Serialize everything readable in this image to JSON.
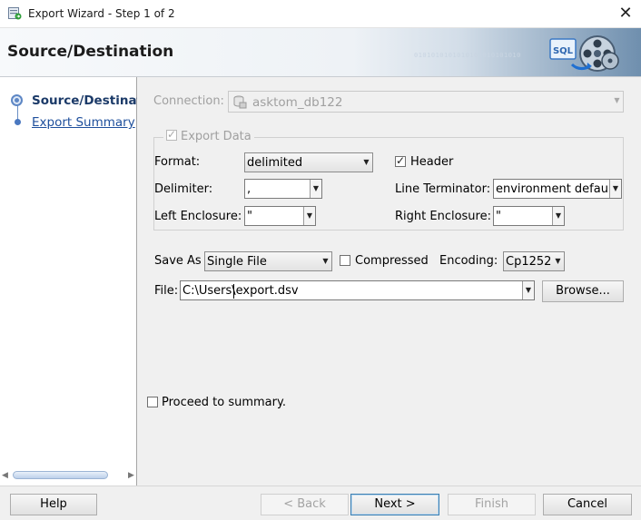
{
  "window": {
    "title": "Export Wizard - Step 1 of 2"
  },
  "header": {
    "title": "Source/Destination",
    "binary_text": "0101010101010101010101010",
    "graphic_label": "SQL"
  },
  "nav": {
    "items": [
      {
        "label": "Source/Destination",
        "state": "current"
      },
      {
        "label": "Export Summary",
        "state": "link"
      }
    ]
  },
  "form": {
    "connection": {
      "label": "Connection:",
      "value": "asktom_db122",
      "enabled": false
    },
    "export_data": {
      "label": "Export Data",
      "checked": true,
      "enabled": false
    },
    "format": {
      "label": "Format:",
      "value": "delimited"
    },
    "header": {
      "label": "Header",
      "checked": true
    },
    "delimiter": {
      "label": "Delimiter:",
      "value": ","
    },
    "line_terminator": {
      "label": "Line Terminator:",
      "value": "environment default"
    },
    "left_enclosure": {
      "label": "Left Enclosure:",
      "value": "\""
    },
    "right_enclosure": {
      "label": "Right Enclosure:",
      "value": "\""
    },
    "save_as": {
      "label": "Save As",
      "value": "Single File"
    },
    "compressed": {
      "label": "Compressed",
      "checked": false
    },
    "encoding": {
      "label": "Encoding:",
      "value": "Cp1252"
    },
    "file": {
      "label": "File:",
      "value": "C:\\Users\\export.dsv",
      "browse_label": "Browse..."
    },
    "proceed": {
      "label": "Proceed to summary.",
      "checked": false
    }
  },
  "footer": {
    "help": "Help",
    "back": "< Back",
    "next": "Next >",
    "finish": "Finish",
    "cancel": "Cancel"
  },
  "colors": {
    "nav_link": "#1e4f9c",
    "accent": "#3c7fb1",
    "disabled_text": "#a0a0a0"
  }
}
